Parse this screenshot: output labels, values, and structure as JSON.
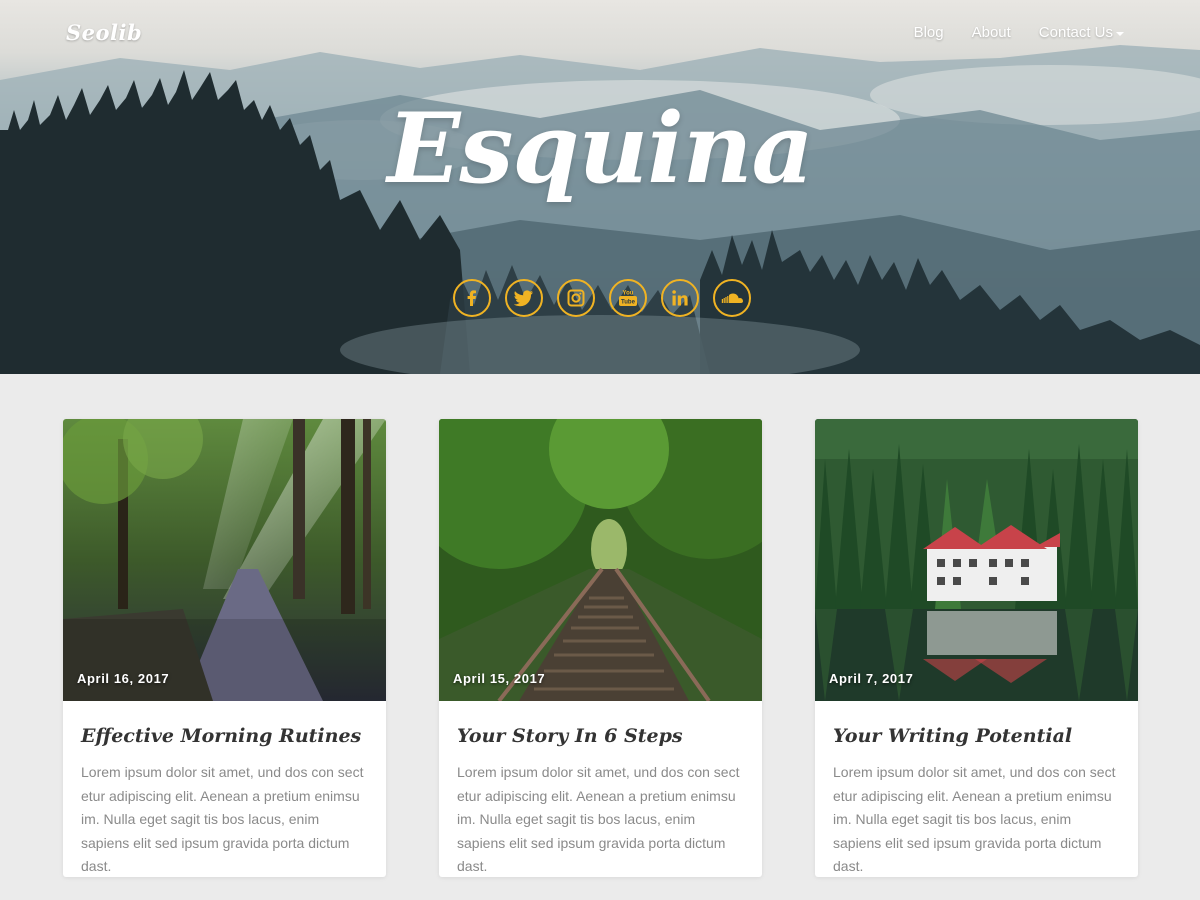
{
  "header": {
    "brand": "Seolib",
    "nav": [
      {
        "label": "Blog"
      },
      {
        "label": "About"
      },
      {
        "label": "Contact Us",
        "dropdown": true
      }
    ]
  },
  "hero": {
    "title": "Esquina",
    "socials": [
      {
        "icon": "facebook-icon"
      },
      {
        "icon": "twitter-icon"
      },
      {
        "icon": "instagram-icon"
      },
      {
        "icon": "youtube-icon"
      },
      {
        "icon": "linkedin-icon"
      },
      {
        "icon": "soundcloud-icon"
      }
    ],
    "accent_color": "#f0b323"
  },
  "posts": [
    {
      "date": "April 16, 2017",
      "title": "Effective Morning Rutines",
      "excerpt": "Lorem ipsum dolor sit amet, und dos con sect etur adipiscing elit. Aenean a pretium enimsu im. Nulla eget sagit tis bos lacus, enim sapiens elit sed ipsum gravida porta dictum dast."
    },
    {
      "date": "April 15, 2017",
      "title": "Your Story In 6 Steps",
      "excerpt": "Lorem ipsum dolor sit amet, und dos con sect etur adipiscing elit. Aenean a pretium enimsu im. Nulla eget sagit tis bos lacus, enim sapiens elit sed ipsum gravida porta dictum dast."
    },
    {
      "date": "April 7, 2017",
      "title": "Your Writing Potential",
      "excerpt": "Lorem ipsum dolor sit amet, und dos con sect etur adipiscing elit. Aenean a pretium enimsu im. Nulla eget sagit tis bos lacus, enim sapiens elit sed ipsum gravida porta dictum dast."
    }
  ]
}
